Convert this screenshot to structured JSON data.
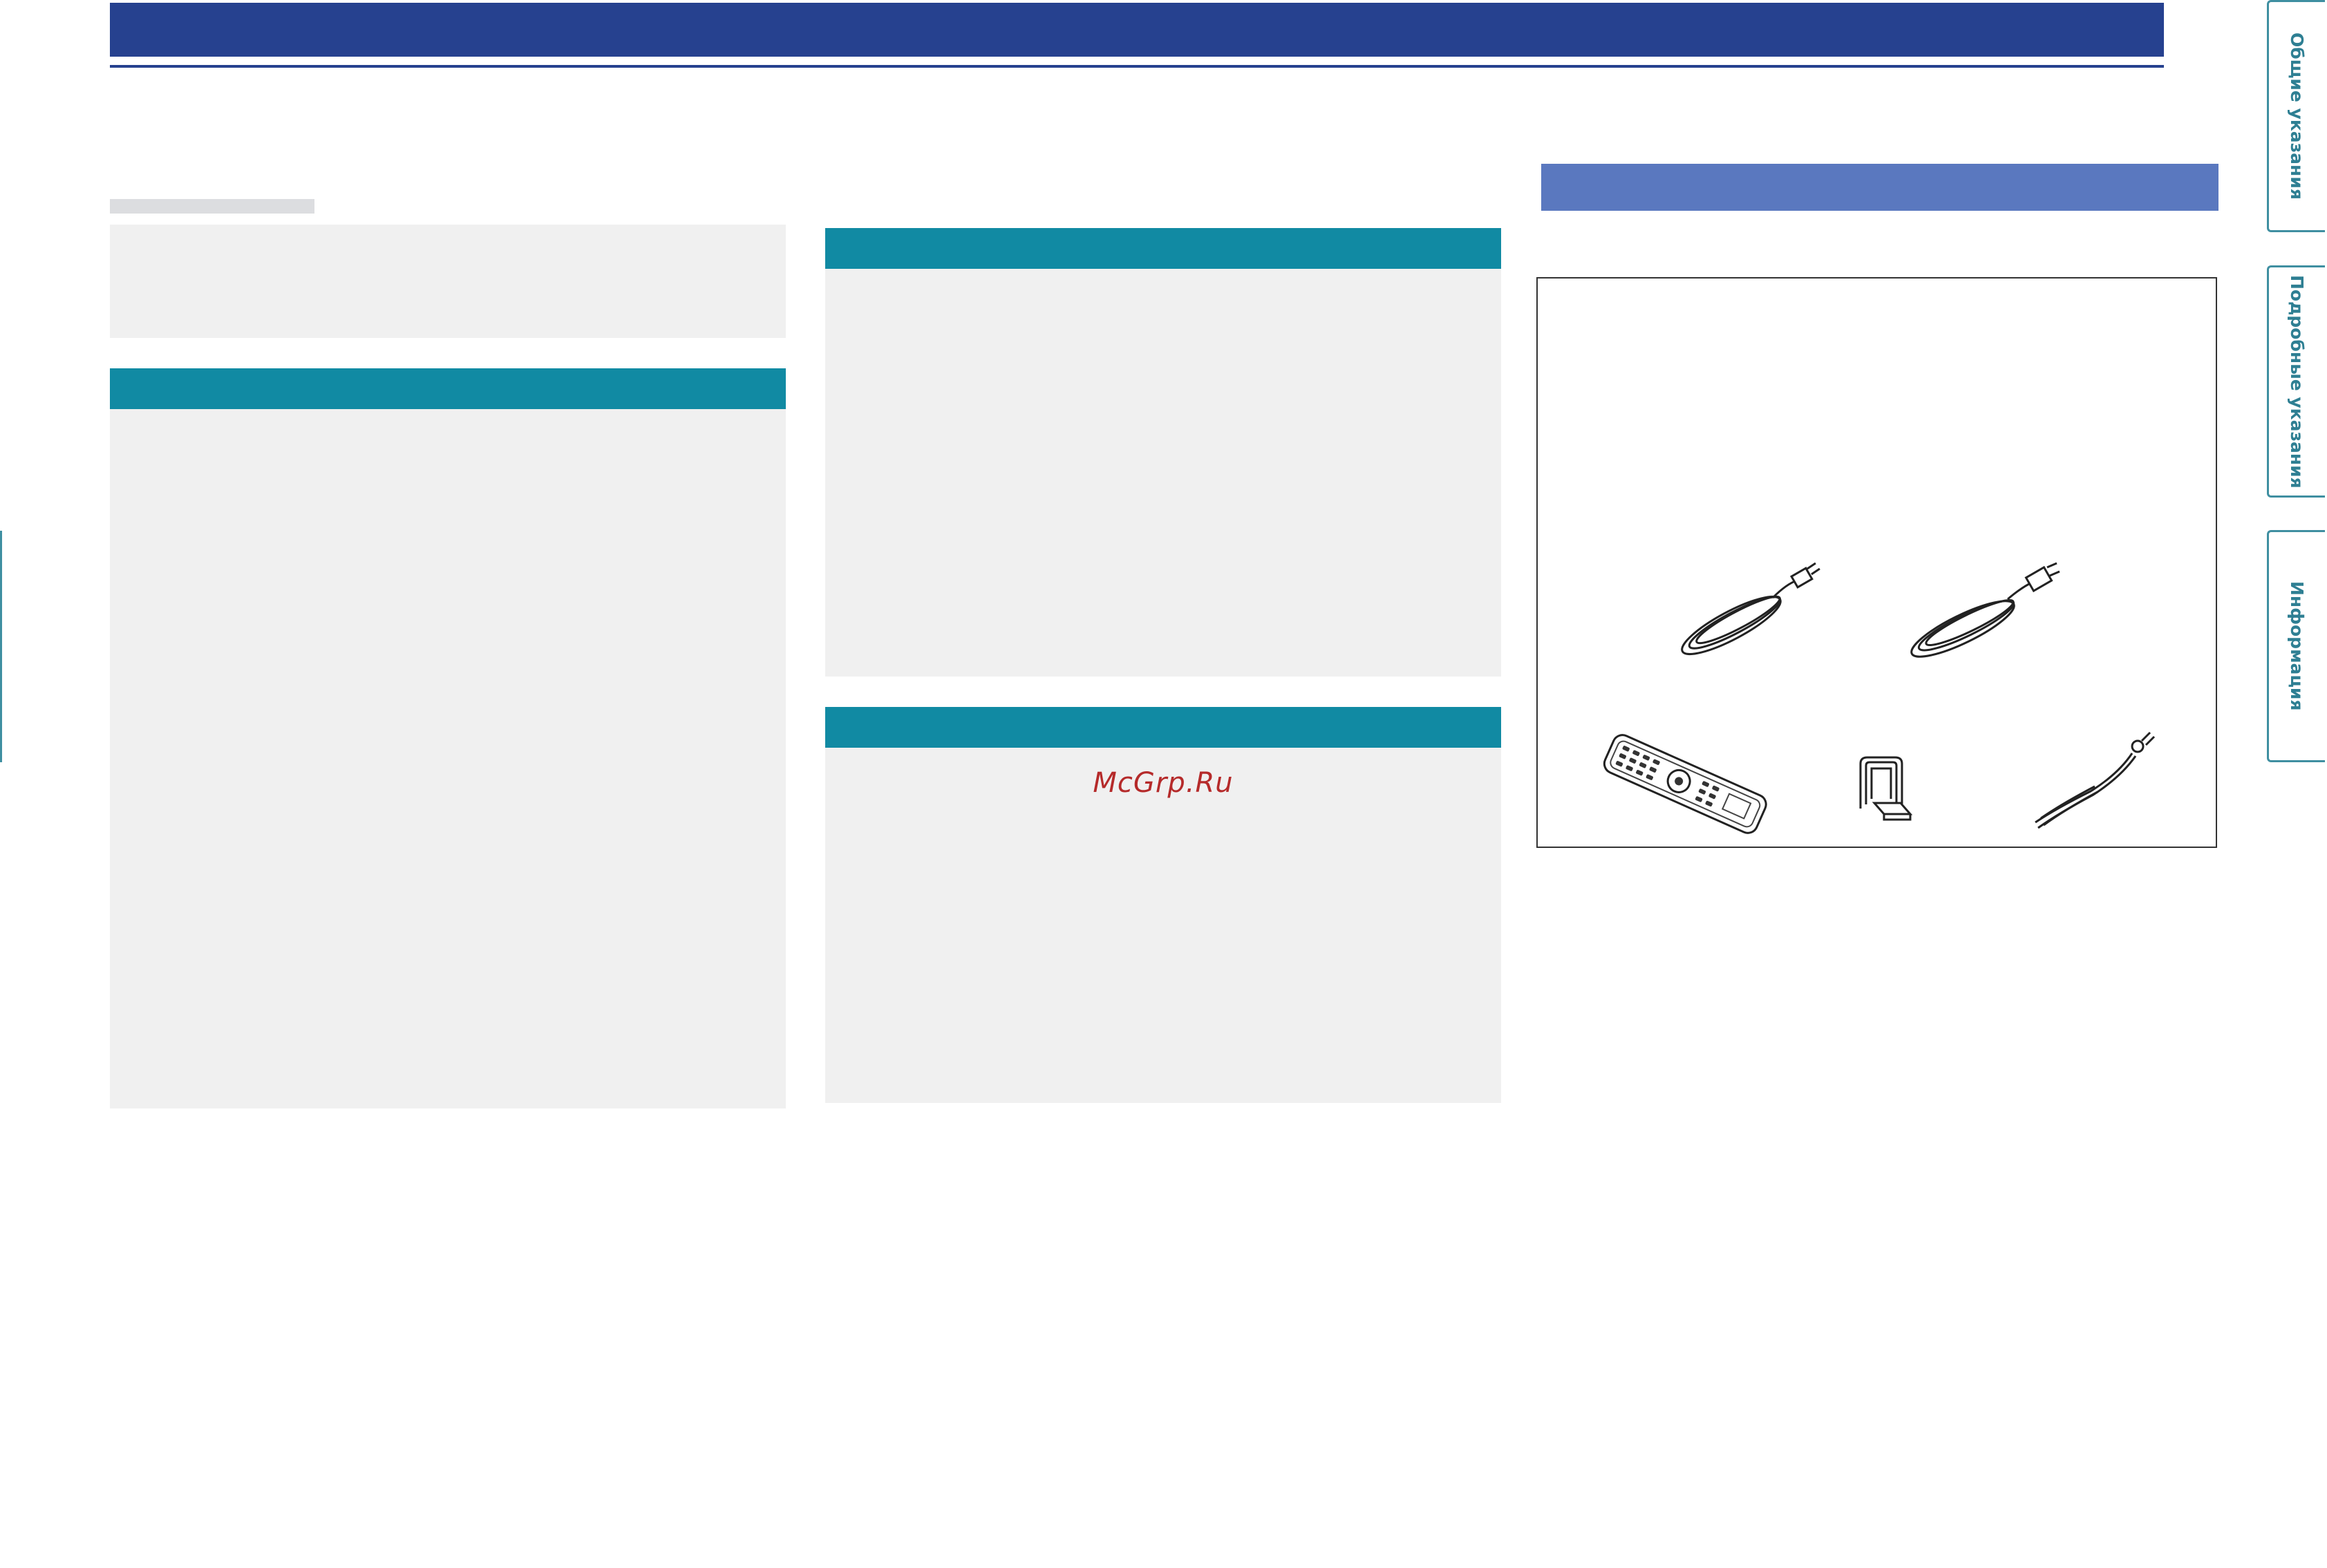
{
  "watermark": "McGrp.Ru",
  "side_tabs": [
    {
      "label": "Общие указания"
    },
    {
      "label": "Подробные указания"
    },
    {
      "label": "Информация"
    }
  ],
  "accessories": [
    {
      "icon": "cable-icon"
    },
    {
      "icon": "cable-icon"
    },
    {
      "icon": "remote-control-icon"
    },
    {
      "icon": "loop-antenna-icon"
    },
    {
      "icon": "fm-antenna-icon"
    }
  ],
  "colors": {
    "header": "#26418f",
    "section_bar": "#118aa3",
    "accent_bar": "#5a78bf",
    "panel": "#f0f0f0",
    "tab_text": "#2e7f93",
    "watermark": "#b52a2a"
  }
}
